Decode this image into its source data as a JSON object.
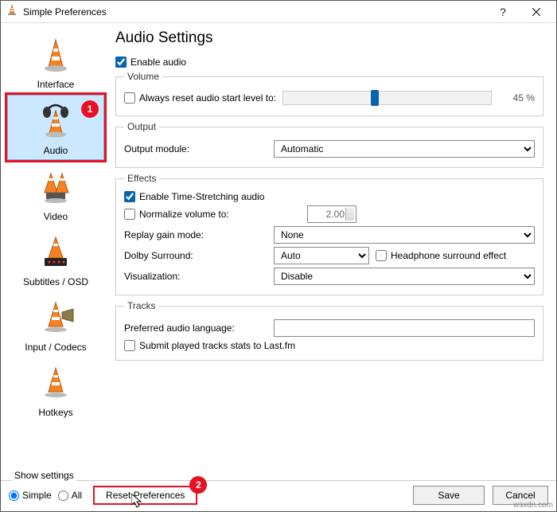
{
  "window": {
    "title": "Simple Preferences"
  },
  "sidebar": {
    "items": [
      {
        "label": "Interface"
      },
      {
        "label": "Audio"
      },
      {
        "label": "Video"
      },
      {
        "label": "Subtitles / OSD"
      },
      {
        "label": "Input / Codecs"
      },
      {
        "label": "Hotkeys"
      }
    ]
  },
  "page": {
    "title": "Audio Settings",
    "enable_audio": "Enable audio",
    "groups": {
      "volume": {
        "legend": "Volume",
        "reset_level": "Always reset audio start level to:",
        "percent": "45 %"
      },
      "output": {
        "legend": "Output",
        "module_label": "Output module:",
        "module_value": "Automatic"
      },
      "effects": {
        "legend": "Effects",
        "timestretch": "Enable Time-Stretching audio",
        "normalize": "Normalize volume to:",
        "normalize_value": "2.00",
        "replay_gain_label": "Replay gain mode:",
        "replay_gain_value": "None",
        "dolby_label": "Dolby Surround:",
        "dolby_value": "Auto",
        "headphone": "Headphone surround effect",
        "viz_label": "Visualization:",
        "viz_value": "Disable"
      },
      "tracks": {
        "legend": "Tracks",
        "pref_lang_label": "Preferred audio language:",
        "pref_lang_value": "",
        "lastfm": "Submit played tracks stats to Last.fm"
      }
    }
  },
  "footer": {
    "show_settings": "Show settings",
    "simple": "Simple",
    "all": "All",
    "reset": "Reset Preferences",
    "save": "Save",
    "cancel": "Cancel"
  },
  "annotations": {
    "badge1": "1",
    "badge2": "2"
  },
  "watermark": "wsxdn.com"
}
